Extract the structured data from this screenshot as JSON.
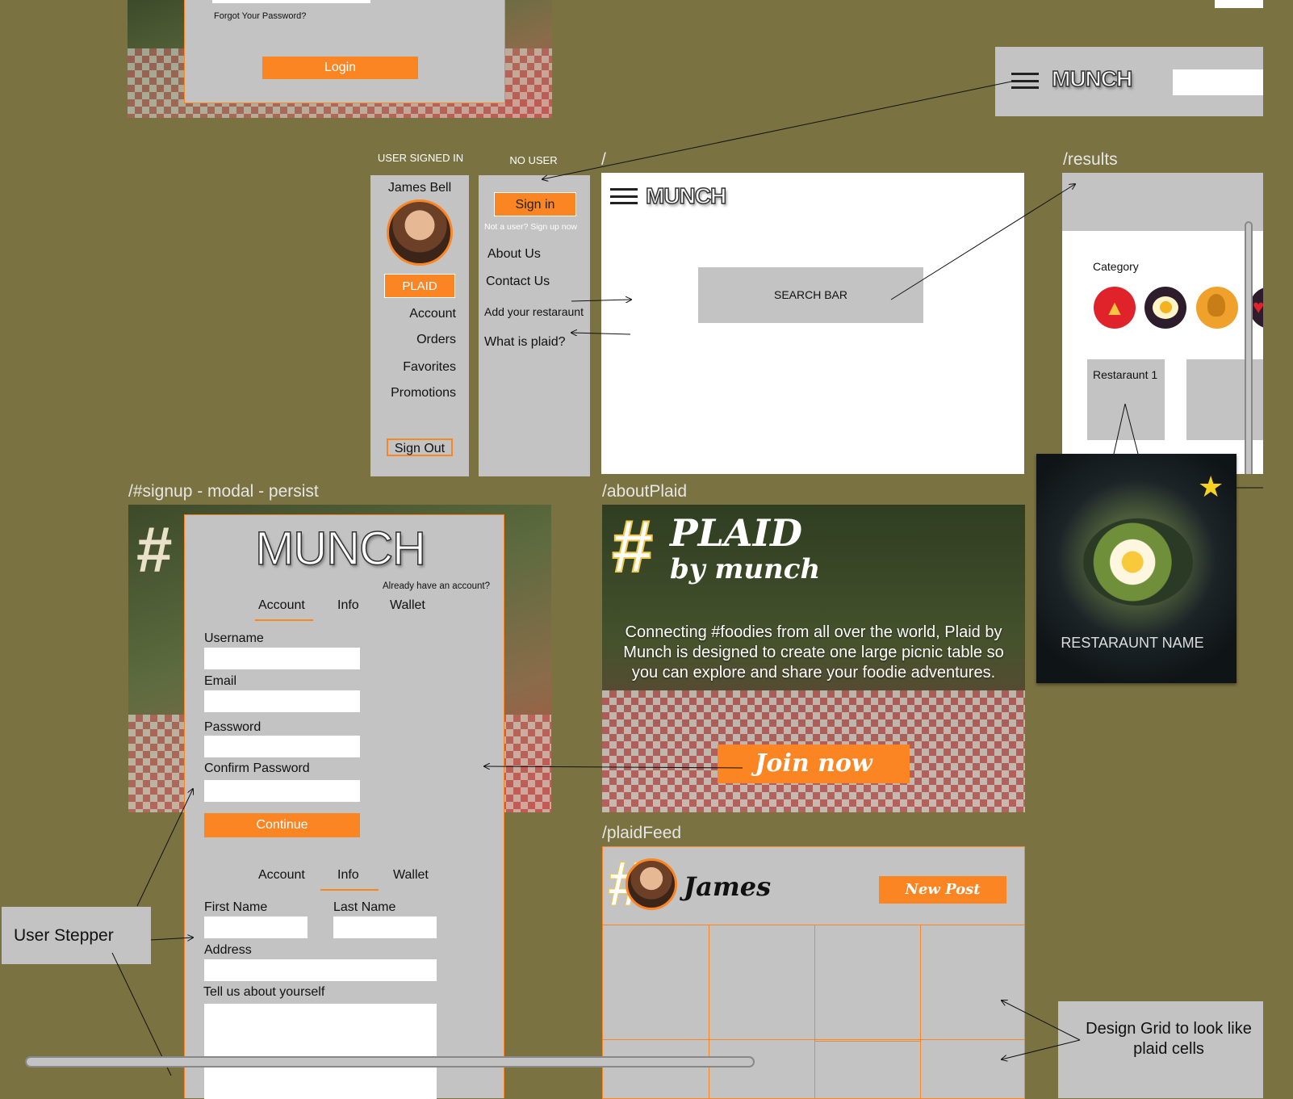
{
  "login_panel": {
    "forgot": "Forgot Your Password?",
    "login_button": "Login"
  },
  "header_preview": {
    "logo": "MUNCH"
  },
  "signed_in_menu": {
    "caption": "USER SIGNED IN",
    "user_name": "James Bell",
    "plaid_button": "PLAID",
    "items": [
      "Account",
      "Orders",
      "Favorites",
      "Promotions"
    ],
    "sign_out": "Sign Out"
  },
  "no_user_menu": {
    "caption": "NO USER",
    "sign_in": "Sign in",
    "signup_hint": "Not a user? Sign up now",
    "items": [
      "About Us",
      "Contact Us",
      "Add your restaraunt",
      "What is plaid?"
    ]
  },
  "home": {
    "route": "/",
    "logo": "MUNCH",
    "search_bar": "SEARCH BAR"
  },
  "results": {
    "route": "/results",
    "category_label": "Category",
    "categories": [
      {
        "icon": "pizza-icon",
        "color": "#e0232b"
      },
      {
        "icon": "egg-icon",
        "color": "#2c1c2c"
      },
      {
        "icon": "drumstick-icon",
        "color": "#f0a12c"
      },
      {
        "icon": "heart-icon",
        "color": "#2c1c2c"
      }
    ],
    "restaurant_1": "Restaraunt 1",
    "card_name": "RESTARAUNT NAME"
  },
  "signup": {
    "route": "/#signup - modal - persist",
    "logo": "MUNCH",
    "have_account": "Already have an account?",
    "tabs": [
      "Account",
      "Info",
      "Wallet"
    ],
    "fields": {
      "username": "Username",
      "email": "Email",
      "password": "Password",
      "confirm": "Confirm Password"
    },
    "continue": "Continue",
    "tabs2": [
      "Account",
      "Info",
      "Wallet"
    ],
    "info_fields": {
      "first": "First Name",
      "last": "Last Name",
      "address": "Address",
      "about": "Tell us about yourself"
    }
  },
  "about_plaid": {
    "route": "/aboutPlaid",
    "hash": "#",
    "brand": "PLAID",
    "by": "by munch",
    "description": "Connecting #foodies from all over the world, Plaid by Munch is designed to create one large picnic table so you can explore and share your foodie adventures.",
    "join": "Join now"
  },
  "plaid_feed": {
    "route": "/plaidFeed",
    "user": "James",
    "new_post": "New Post"
  },
  "notes": {
    "user_stepper": "User Stepper",
    "design_grid": "Design Grid to look like plaid cells"
  },
  "colors": {
    "accent": "#fb8423",
    "canvas": "#7a7240",
    "panel": "#c3c3c3"
  }
}
